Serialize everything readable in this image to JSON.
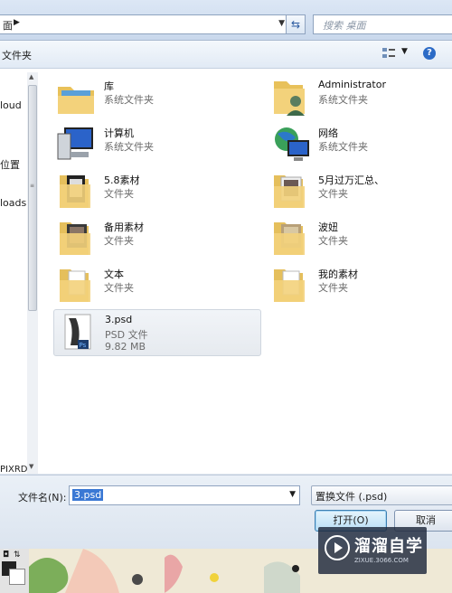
{
  "address_bar": {
    "crumb": "面",
    "search_placeholder": "搜索 桌面"
  },
  "toolbar": {
    "new_folder_label": "文件夹"
  },
  "nav": {
    "items": [
      "loud",
      "位置",
      "loads",
      "PIXRD"
    ]
  },
  "items": [
    {
      "name": "库",
      "type": "系统文件夹",
      "icon": "library-icon"
    },
    {
      "name": "Administrator",
      "type": "系统文件夹",
      "icon": "user-folder-icon"
    },
    {
      "name": "计算机",
      "type": "系统文件夹",
      "icon": "computer-icon"
    },
    {
      "name": "网络",
      "type": "系统文件夹",
      "icon": "network-icon"
    },
    {
      "name": "5.8素材",
      "type": "文件夹",
      "icon": "folder-icon"
    },
    {
      "name": "5月过万汇总、",
      "type": "文件夹",
      "icon": "folder-icon"
    },
    {
      "name": "备用素材",
      "type": "文件夹",
      "icon": "folder-icon"
    },
    {
      "name": "波妞",
      "type": "文件夹",
      "icon": "folder-icon"
    },
    {
      "name": "文本",
      "type": "文件夹",
      "icon": "folder-icon"
    },
    {
      "name": "我的素材",
      "type": "文件夹",
      "icon": "folder-icon"
    },
    {
      "name": "3.psd",
      "type": "PSD 文件",
      "size": "9.82 MB",
      "icon": "psd-file-icon"
    }
  ],
  "bottom": {
    "filename_label": "文件名(N):",
    "filename_value": "3.psd",
    "filetype_value": "置换文件 (.psd)",
    "open_label": "打开(O)",
    "cancel_label": "取消"
  },
  "watermark": {
    "title": "溜溜自学",
    "url": "ZIXUE.3066.COM"
  }
}
